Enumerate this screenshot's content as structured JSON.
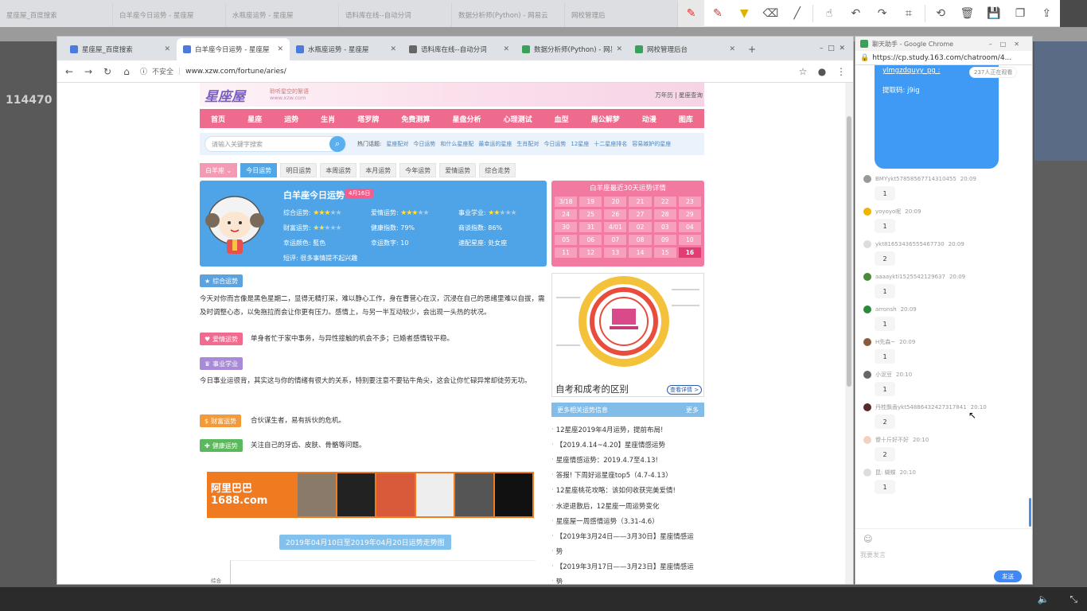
{
  "background": {
    "tabs": [
      "星座屋_百度搜索",
      "白羊座今日运势 - 星座屋",
      "水瓶座运势 - 星座屋",
      "语料库在线--自动分词",
      "数据分析师(Python) - 网易云",
      "网校管理后"
    ],
    "side_number": "114470"
  },
  "annotation_toolbar": {
    "icons": [
      "pen-icon",
      "pen-icon",
      "highlighter-icon",
      "eraser-icon",
      "line-icon",
      "select-icon",
      "undo-icon",
      "redo-icon",
      "crop-icon",
      "history-icon",
      "delete-icon",
      "save-icon",
      "copy-icon",
      "share-icon"
    ]
  },
  "browser": {
    "tabs": [
      {
        "title": "星座屋_百度搜索",
        "color": "#4c7be0"
      },
      {
        "title": "白羊座今日运势 - 星座屋",
        "color": "#4c7be0"
      },
      {
        "title": "水瓶座运势 - 星座屋",
        "color": "#4c7be0"
      },
      {
        "title": "语料库在线--自动分词",
        "color": "#666666"
      },
      {
        "title": "数据分析师(Python) - 网易云",
        "color": "#3aa05b"
      },
      {
        "title": "网校管理后台",
        "color": "#3aa05b"
      }
    ],
    "url_insecure": "不安全",
    "url": "www.xzw.com/fortune/aries/"
  },
  "site": {
    "logo": "星座屋",
    "logo_slogan": "聆听星空的絮语",
    "logo_url": "www.xzw.com",
    "header_links": "万年历 | 星座查询",
    "nav": [
      "首页",
      "星座",
      "运势",
      "生肖",
      "塔罗牌",
      "免费测算",
      "星盘分析",
      "心理测试",
      "血型",
      "周公解梦",
      "动漫",
      "图库"
    ],
    "search_placeholder": "请输入关键字搜索",
    "hot_label": "热门话题:",
    "hot_topics": [
      "星座配对",
      "今日运势",
      "和什么星座配",
      "最幸运的星座",
      "生肖配对",
      "今日运势",
      "12星座",
      "十二星座排名",
      "容易嫉妒的星座"
    ],
    "sign_select": "白羊座",
    "tabs": [
      "今日运势",
      "明日运势",
      "本周运势",
      "本月运势",
      "今年运势",
      "爱情运势",
      "综合走势"
    ],
    "card": {
      "title": "白羊座今日运势",
      "date": "4月16日",
      "overall_label": "综合运势:",
      "love_label": "爱情运势:",
      "career_label": "事业学业:",
      "wealth_label": "财富运势:",
      "health_label": "健康指数:",
      "health_value": "79%",
      "negotiation_label": "商谈指数:",
      "negotiation_value": "86%",
      "color_label": "幸运颜色:",
      "color_value": "藍色",
      "number_label": "幸运数字:",
      "number_value": "10",
      "match_label": "速配星座:",
      "match_value": "处女座",
      "summary_label": "短评:",
      "summary_value": "很多事情提不起兴趣",
      "overall_stars": 3,
      "love_stars": 3,
      "career_stars": 2,
      "wealth_stars": 2
    },
    "calendar": {
      "title": "白羊座最近30天运势详情",
      "days": [
        "3/18",
        "19",
        "20",
        "21",
        "22",
        "23",
        "24",
        "25",
        "26",
        "27",
        "28",
        "29",
        "30",
        "31",
        "4/01",
        "02",
        "03",
        "04",
        "05",
        "06",
        "07",
        "08",
        "09",
        "10",
        "11",
        "12",
        "13",
        "14",
        "15",
        "16"
      ]
    },
    "sections": {
      "overall": {
        "label": "综合运势",
        "text": "今天对你而言像是黑色星期二，显得无精打采，难以静心工作，身在曹营心在汉，沉浸在自己的思绪里难以自拔，需及时调整心态，以免拖拉而会让你更有压力。感情上，与另一半互动较少，会出现一头热的状况。",
        "color": "#5aa3e0"
      },
      "love": {
        "label": "爱情运势",
        "text": "单身者忙于家中事务，与异性接触的机会不多；已婚者感情较平稳。",
        "color": "#f26b8e"
      },
      "career": {
        "label": "事业学业",
        "text": "今日事业运很背，其实这与你的情绪有很大的关系，特别要注意不要钻牛角尖，这会让你忙碌异常却徒劳无功。",
        "color": "#a98ad9"
      },
      "wealth": {
        "label": "财富运势",
        "text": "合伙谋生者，易有拆伙的危机。",
        "color": "#f39a3a"
      },
      "health": {
        "label": "健康运势",
        "text": "关注自己的牙齿、皮肤、骨骼等问题。",
        "color": "#5cb85c"
      }
    },
    "ad": {
      "logo_line1": "阿里巴巴",
      "logo_line2": "1688.com"
    },
    "trend_title": "2019年04月10日至2019年04月20日运势走势图",
    "chart_ylabel": "综合",
    "promo": {
      "title": "自考和成考的区别",
      "button": "查看详情 >"
    },
    "more": {
      "title": "更多相关运势信息",
      "link": "更多"
    },
    "related": [
      "12星座2019年4月运势，提前布局!",
      "【2019.4.14~4.20】星座情感运势",
      "星座情感运势：2019.4.7至4.13!",
      "答报! 下周好运星座top5（4.7-4.13）",
      "12星座桃花攻略：该如何收获完美爱情!",
      "水逆退散后，12星座一周运势变化",
      "星座屋一周感情运势（3.31-4.6）",
      "【2019年3月24日——3月30日】星座情感运",
      "势",
      "【2019年3月17日——3月23日】星座情感运",
      "势"
    ]
  },
  "chat": {
    "window_title": "聊天助手 - Google Chrome",
    "url": "https://cp.study.163.com/chatroom/4...",
    "bubble_line1": "ylmgzdquyy_pg :",
    "bubble_line2": "提取码: j9ig",
    "viewers": "237人正在观看",
    "messages": [
      {
        "user": "BMYykt578585677143104​55",
        "time": "20:09",
        "text": "1",
        "color": "#999999"
      },
      {
        "user": "yoyoyo呢",
        "time": "20:09",
        "text": "1",
        "color": "#f0b400"
      },
      {
        "user": "ykt81653436555467730",
        "time": "20:09",
        "text": "2",
        "color": "#dddddd"
      },
      {
        "user": "aaaayktl1525542129637",
        "time": "20:09",
        "text": "1",
        "color": "#4a8a3a"
      },
      {
        "user": "arronsh",
        "time": "20:09",
        "text": "1",
        "color": "#2a8a3a"
      },
      {
        "user": "H先森~",
        "time": "20:09",
        "text": "1",
        "color": "#8a5a3a"
      },
      {
        "user": "小泥豆",
        "time": "20:10",
        "text": "1",
        "color": "#666666"
      },
      {
        "user": "丹桂飘香ykt54886432427317841",
        "time": "20:10",
        "text": "2",
        "color": "#5a2a2a"
      },
      {
        "user": "傻十斤好不好",
        "time": "20:10",
        "text": "2",
        "color": "#f5d0c0"
      },
      {
        "user": "昆: 蝴蝶",
        "time": "20:10",
        "text": "1",
        "color": "#dddddd"
      }
    ],
    "input_placeholder": "我要发言",
    "send": "发送"
  }
}
